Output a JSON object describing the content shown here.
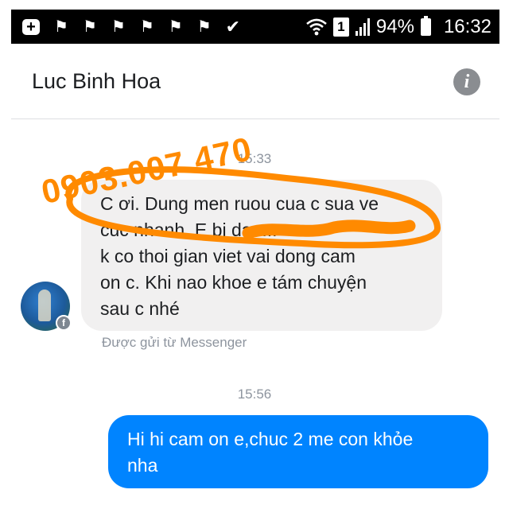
{
  "status_bar": {
    "icons": [
      "plus-notification-icon",
      "flag-icon",
      "flag-icon",
      "flag-icon",
      "flag-icon",
      "flag-icon",
      "flag-icon",
      "check-icon",
      "wifi-icon",
      "sim-icon",
      "signal-icon",
      "battery-icon"
    ],
    "sim_slot": "1",
    "battery": "94%",
    "time": "16:32"
  },
  "header": {
    "contact_name": "Luc Binh Hoa",
    "info_icon": "info-icon"
  },
  "messages": [
    {
      "timestamp": "15:33",
      "direction": "incoming",
      "text": "C ơi. Dung men ruou cua c sua ve\ncuc nhanh. E bi dau...\nk co thoi gian viet vai dong cam\non c. Khi nao khoe e tám chuyện\nsau c nhé",
      "sent_via": "Được gửi từ Messenger"
    },
    {
      "timestamp": "15:56",
      "direction": "outgoing",
      "text": "Hi hi cam on e,chuc 2 me con khỏe\nnha"
    }
  ],
  "annotation": {
    "watermark_text": "0903.007.470",
    "color": "#ff8a00"
  },
  "colors": {
    "outgoing_bubble": "#0084ff",
    "incoming_bubble": "#f1f0f0",
    "status_bar": "#000000"
  }
}
